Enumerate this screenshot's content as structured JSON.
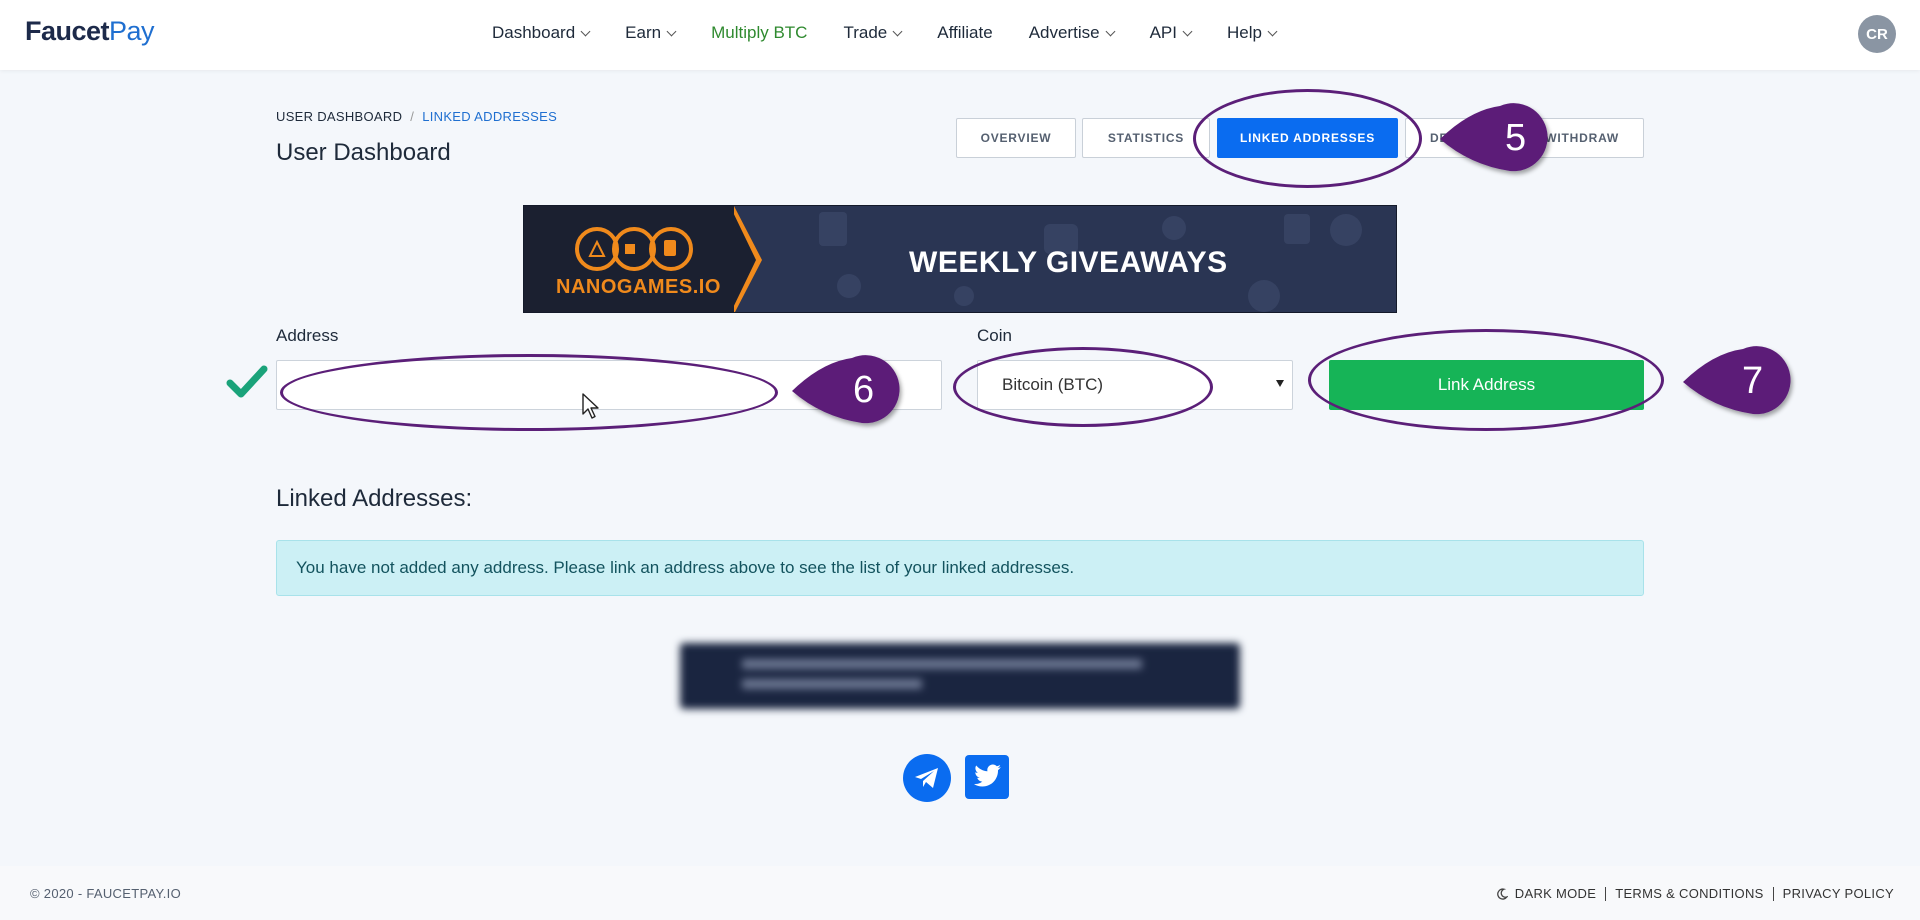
{
  "logo": {
    "part1": "Faucet",
    "part2": "Pay"
  },
  "nav": {
    "items": [
      {
        "label": "Dashboard",
        "dropdown": true
      },
      {
        "label": "Earn",
        "dropdown": true
      },
      {
        "label": "Multiply BTC",
        "dropdown": false
      },
      {
        "label": "Trade",
        "dropdown": true
      },
      {
        "label": "Affiliate",
        "dropdown": false
      },
      {
        "label": "Advertise",
        "dropdown": true
      },
      {
        "label": "API",
        "dropdown": true
      },
      {
        "label": "Help",
        "dropdown": true
      }
    ],
    "avatar_initials": "CR"
  },
  "breadcrumb": {
    "root": "USER DASHBOARD",
    "separator": "/",
    "current": "LINKED ADDRESSES"
  },
  "page_title": "User Dashboard",
  "tabs": [
    {
      "label": "OVERVIEW"
    },
    {
      "label": "STATISTICS"
    },
    {
      "label": "LINKED ADDRESSES",
      "active": true
    },
    {
      "label": "DEPOSIT"
    },
    {
      "label": "WITHDRAW"
    }
  ],
  "banner": {
    "brand": "NANOGAMES.IO",
    "headline": "WEEKLY GIVEAWAYS"
  },
  "form": {
    "address_label": "Address",
    "address_value": "",
    "coin_label": "Coin",
    "coin_selected": "Bitcoin (BTC)",
    "submit_label": "Link Address"
  },
  "linked": {
    "title": "Linked Addresses:",
    "empty_message": "You have not added any address. Please link an address above to see the list of your linked addresses."
  },
  "social": [
    "telegram-icon",
    "twitter-icon"
  ],
  "footer": {
    "copyright": "© 2020 - FAUCETPAY.IO",
    "links": [
      "DARK MODE",
      "TERMS & CONDITIONS",
      "PRIVACY POLICY"
    ]
  },
  "annotations": {
    "markers": [
      "5",
      "6",
      "7"
    ]
  },
  "colors": {
    "primary": "#0a6cf0",
    "success": "#16b457",
    "annotation": "#5b1f78",
    "alert_bg": "#ccf0f5"
  }
}
